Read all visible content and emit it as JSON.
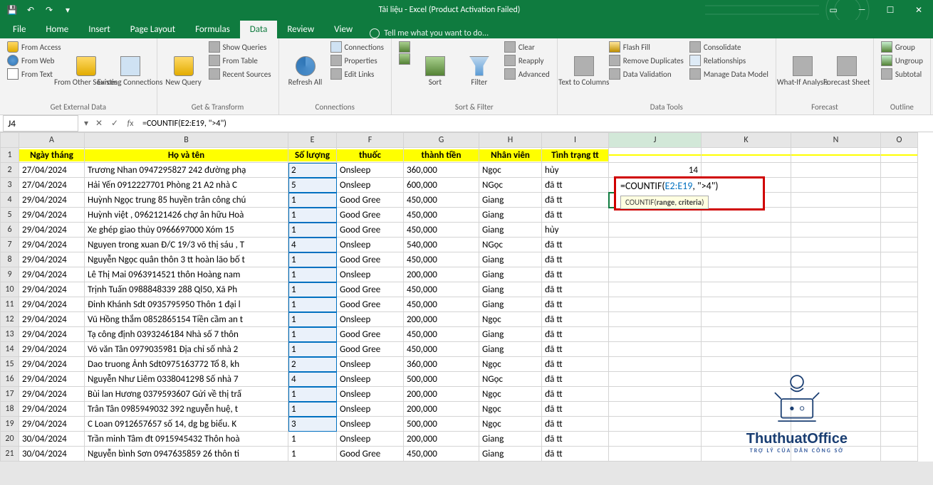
{
  "title": "Tài liệu - Excel (Product Activation Failed)",
  "tabs": [
    "File",
    "Home",
    "Insert",
    "Page Layout",
    "Formulas",
    "Data",
    "Review",
    "View"
  ],
  "active_tab": "Data",
  "tell_me": "Tell me what you want to do...",
  "ribbon": {
    "g1": {
      "label": "Get External Data",
      "items": [
        "From Access",
        "From Web",
        "From Text",
        "From Other Sources",
        "Existing Connections"
      ]
    },
    "g2": {
      "label": "Get & Transform",
      "items": [
        "New Query",
        "Show Queries",
        "From Table",
        "Recent Sources"
      ]
    },
    "g3": {
      "label": "Connections",
      "items": [
        "Refresh All",
        "Connections",
        "Properties",
        "Edit Links"
      ]
    },
    "g4": {
      "label": "Sort & Filter",
      "items": [
        "Sort",
        "Filter",
        "Clear",
        "Reapply",
        "Advanced"
      ]
    },
    "g5": {
      "label": "Data Tools",
      "items": [
        "Text to Columns",
        "Flash Fill",
        "Remove Duplicates",
        "Data Validation",
        "Consolidate",
        "Relationships",
        "Manage Data Model"
      ]
    },
    "g6": {
      "label": "Forecast",
      "items": [
        "What-If Analysis",
        "Forecast Sheet"
      ]
    },
    "g7": {
      "label": "Outline",
      "items": [
        "Group",
        "Ungroup",
        "Subtotal"
      ]
    }
  },
  "name_box": "J4",
  "formula": "=COUNTIF(E2:E19, \">4\")",
  "formula_display": {
    "pre": "=COUNTIF(",
    "range": "E2:E19",
    "post": ", \">4\")"
  },
  "formula_tip": "COUNTIF(range, criteria)",
  "columns": [
    "A",
    "B",
    "E",
    "F",
    "G",
    "H",
    "I",
    "J",
    "K",
    "N",
    "O"
  ],
  "col_widths": {
    "A": 92,
    "B": 286,
    "E": 68,
    "F": 94,
    "G": 106,
    "H": 88,
    "I": 94,
    "J": 130,
    "K": 126,
    "N": 126,
    "O": 52
  },
  "headers": {
    "A": "Ngày tháng",
    "B": "Họ và tên",
    "E": "Số lượng",
    "F": "thuốc",
    "G": "thành tiền",
    "H": "Nhân viên",
    "I": "Tình trạng tt"
  },
  "j2_value": "14",
  "rows": [
    {
      "n": 2,
      "A": "27/04/2024",
      "B": "Trương Nhan 0947295827 242 đường phạ",
      "E": "2",
      "F": "Onsleep",
      "G": "360,000",
      "H": "Ngọc",
      "I": "hủy"
    },
    {
      "n": 3,
      "A": "27/04/2024",
      "B": "Hải Yến 0912227701 Phòng 21 A2 nhà C",
      "E": "5",
      "F": "Onsleep",
      "G": "600,000",
      "H": "NGọc",
      "I": "đã tt"
    },
    {
      "n": 4,
      "A": "29/04/2024",
      "B": "Huỳnh Ngọc trung 85 huyền trân công chú",
      "E": "1",
      "F": "Good Gree",
      "G": "450,000",
      "H": "Giang",
      "I": "đã tt"
    },
    {
      "n": 5,
      "A": "29/04/2024",
      "B": "Huỳnh việt , 0962121426 chợ ân hữu Hoà",
      "E": "1",
      "F": "Good Gree",
      "G": "450,000",
      "H": "Giang",
      "I": "đã tt"
    },
    {
      "n": 6,
      "A": "29/04/2024",
      "B": "Xe ghép giao thủy 0966697000 Xóm 15",
      "E": "1",
      "F": "Good Gree",
      "G": "450,000",
      "H": "Giang",
      "I": "hủy"
    },
    {
      "n": 7,
      "A": "29/04/2024",
      "B": "Nguyen trong xuan Đ/C 19/3 võ thị sáu , T",
      "E": "4",
      "F": "Onsleep",
      "G": "540,000",
      "H": "NGọc",
      "I": "đã tt"
    },
    {
      "n": 8,
      "A": "29/04/2024",
      "B": "Nguyễn Ngọc quân thôn 3 tt hoàn lão bố t",
      "E": "1",
      "F": "Good Gree",
      "G": "450,000",
      "H": "Giang",
      "I": "đã tt"
    },
    {
      "n": 9,
      "A": "29/04/2024",
      "B": "Lê Thị Mai 0963914521 thôn Hoàng nam",
      "E": "1",
      "F": "Onsleep",
      "G": "200,000",
      "H": "Giang",
      "I": "đã tt"
    },
    {
      "n": 10,
      "A": "29/04/2024",
      "B": "Trịnh Tuấn 0988848339 288 Ql50, Xã Ph",
      "E": "1",
      "F": "Good Gree",
      "G": "450,000",
      "H": "Giang",
      "I": "đã tt"
    },
    {
      "n": 11,
      "A": "29/04/2024",
      "B": "Đinh Khánh Sdt 0935795950 Thôn 1 đại l",
      "E": "1",
      "F": "Good Gree",
      "G": "450,000",
      "H": "Giang",
      "I": "đã tt"
    },
    {
      "n": 12,
      "A": "29/04/2024",
      "B": "Vũ Hồng thắm 0852865154 Tiền cầm an t",
      "E": "1",
      "F": "Onsleep",
      "G": "200,000",
      "H": "Ngọc",
      "I": "đã tt"
    },
    {
      "n": 13,
      "A": "29/04/2024",
      "B": "Tạ công định 0393246184 Nhà số 7 thôn",
      "E": "1",
      "F": "Good Gree",
      "G": "450,000",
      "H": "Giang",
      "I": "đã tt"
    },
    {
      "n": 14,
      "A": "29/04/2024",
      "B": " Võ văn Tân 0979035981 Địa chỉ số nhà 2",
      "E": "1",
      "F": "Good Gree",
      "G": "450,000",
      "H": "Giang",
      "I": "đã tt"
    },
    {
      "n": 15,
      "A": "29/04/2024",
      "B": "Dao truong Ảnh  Sdt0975163772 Tổ 8, kh",
      "E": "2",
      "F": "Onsleep",
      "G": "360,000",
      "H": "Ngọc",
      "I": "đã tt"
    },
    {
      "n": 16,
      "A": "29/04/2024",
      "B": "Nguyễn Như Liêm 0338041298 Số nhà 7",
      "E": "4",
      "F": "Onsleep",
      "G": "500,000",
      "H": "NGọc",
      "I": "đã tt"
    },
    {
      "n": 17,
      "A": "29/04/2024",
      "B": "Bùi lan Hương 0379593607 Gửi về thị trấ",
      "E": "1",
      "F": "Onsleep",
      "G": "200,000",
      "H": "Ngọc",
      "I": "đã tt"
    },
    {
      "n": 18,
      "A": "29/04/2024",
      "B": "Trân Tân 0985949032 392  nguyễn huệ, t",
      "E": "1",
      "F": "Onsleep",
      "G": "200,000",
      "H": "Ngọc",
      "I": "đã tt"
    },
    {
      "n": 19,
      "A": "29/04/2024",
      "B": "C Loan 0912657657 số 14, dg bg biểu. K",
      "E": "3",
      "F": "Onsleep",
      "G": "500,000",
      "H": "Ngọc",
      "I": "đã tt"
    },
    {
      "n": 20,
      "A": "30/04/2024",
      "B": " Trần minh Tâm đt 0915945432 Thôn hoà",
      "E": "1",
      "F": "Onsleep",
      "G": "200,000",
      "H": "Giang",
      "I": "đã tt"
    },
    {
      "n": 21,
      "A": "30/04/2024",
      "B": "Nguyễn bình Sơn 0947635859 26 thôn ti",
      "E": "1",
      "F": "Good Gree",
      "G": "450,000",
      "H": "Giang",
      "I": "đã tt"
    }
  ],
  "watermark": {
    "text": "ThuthuatOffice",
    "sub": "TRỢ LÝ CỦA DÂN CÔNG SỞ"
  }
}
